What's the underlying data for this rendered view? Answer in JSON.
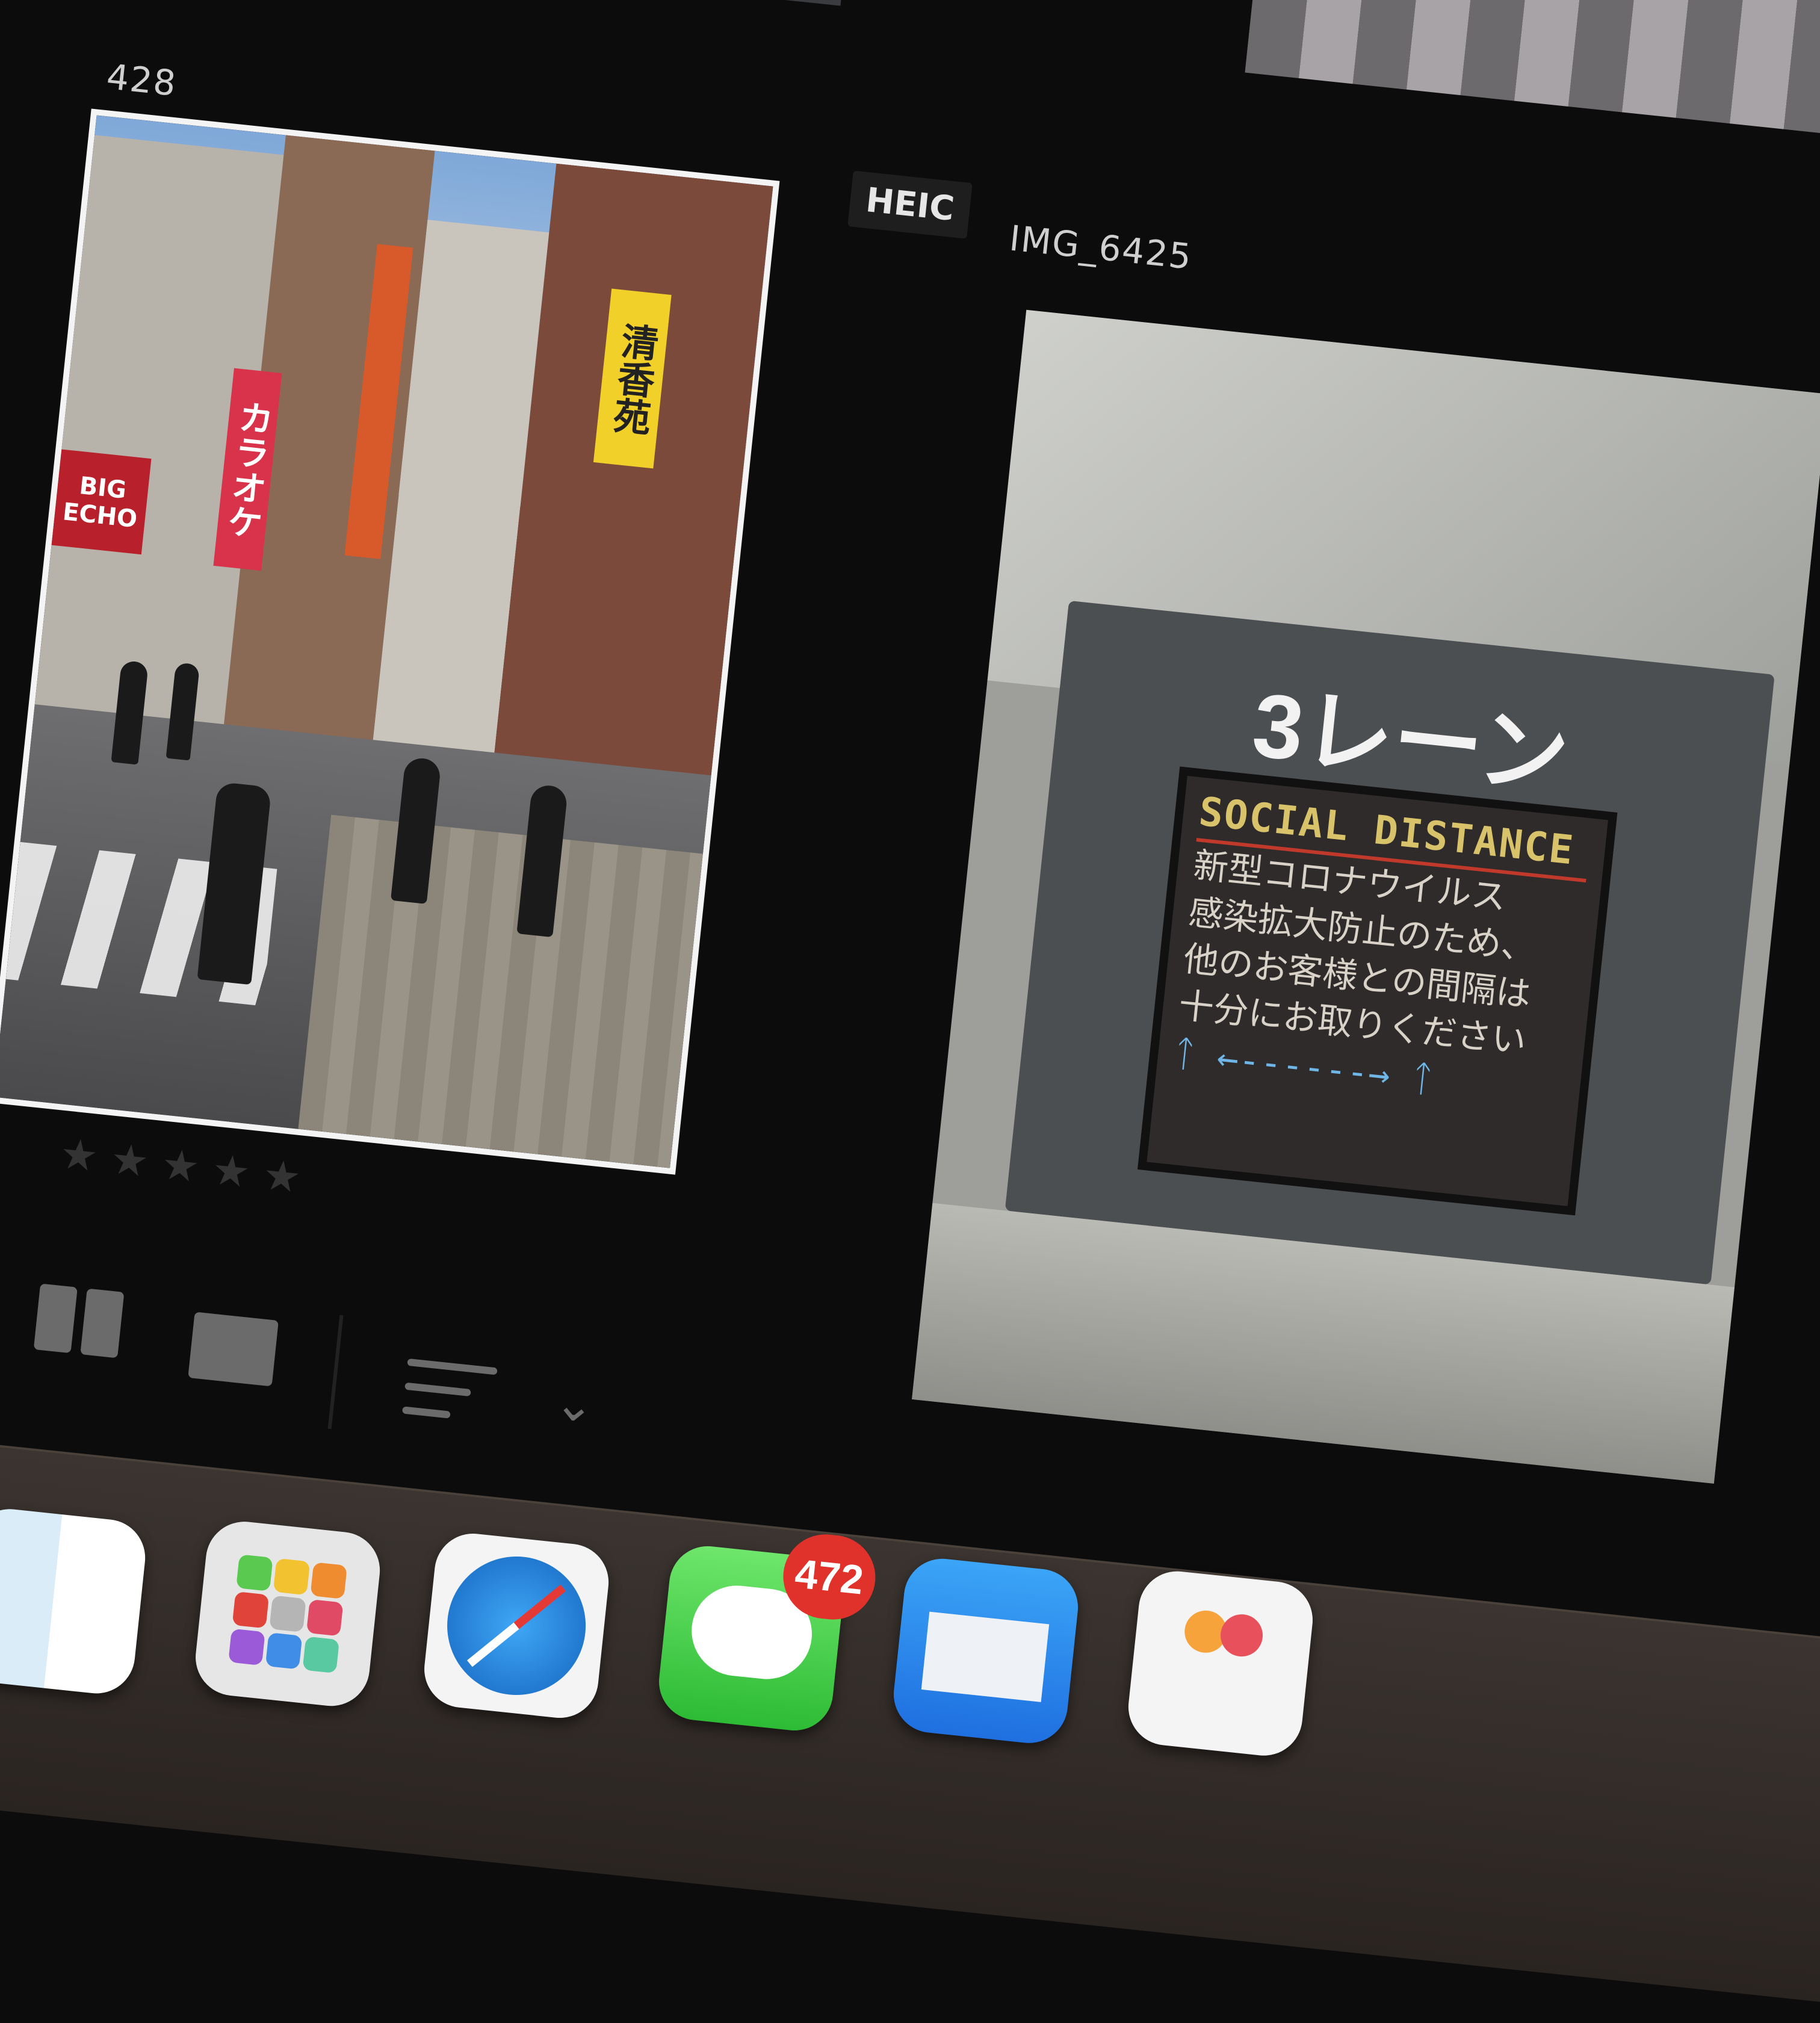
{
  "grid": {
    "left_tile": {
      "title": "428",
      "format_badge": "HEIC",
      "rating_stars": "★★★★★",
      "signs": {
        "karaoke": "カラオケ",
        "big_echo": "BIG ECHO",
        "yellow": "清香苑"
      }
    },
    "right_tile": {
      "title": "IMG_6425",
      "lane_label": "3レーン",
      "led_header": "SOCIAL DISTANCE",
      "led_lines": [
        "新型コロナウイルス",
        "感染拡大防止のため、",
        "他のお客様との間隔は",
        "十分にお取りください"
      ],
      "led_arrow": "ᛏ ←------→ ᛏ"
    }
  },
  "toolbar": {
    "grid_view_icon": "grid-view-icon",
    "loupe_view_icon": "loupe-view-icon",
    "sort_icon": "sort-icon",
    "chevron": "⌄"
  },
  "dock": {
    "apps": [
      {
        "name": "finder",
        "icon": "finder-icon"
      },
      {
        "name": "launchpad",
        "icon": "launchpad-icon"
      },
      {
        "name": "safari",
        "icon": "safari-icon"
      },
      {
        "name": "messages",
        "icon": "messages-icon",
        "badge": "472"
      },
      {
        "name": "mail",
        "icon": "mail-icon"
      },
      {
        "name": "photos",
        "icon": "photos-icon"
      }
    ]
  }
}
